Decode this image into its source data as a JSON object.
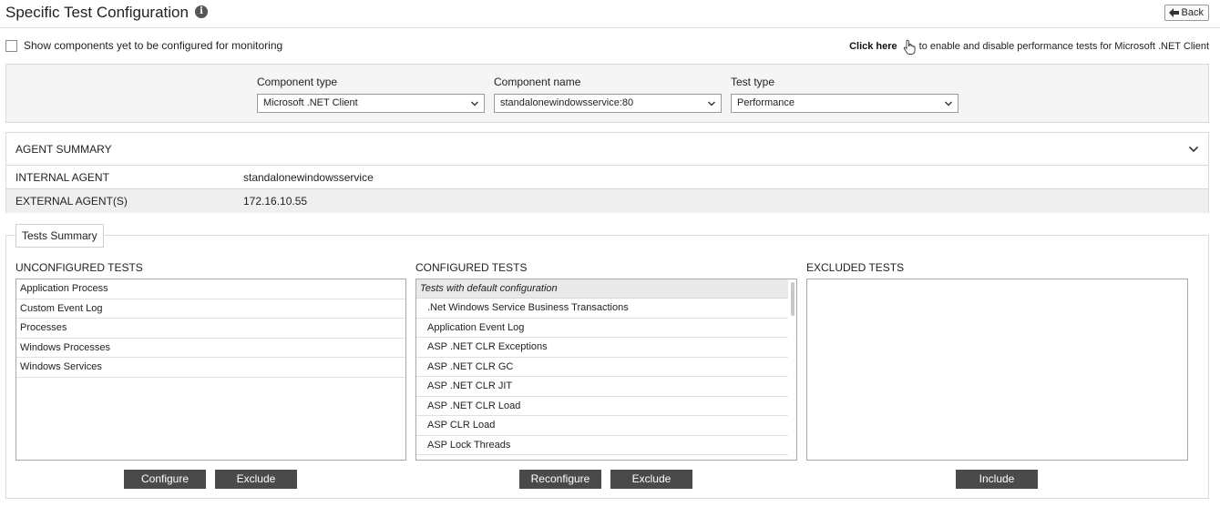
{
  "header": {
    "title": "Specific Test Configuration",
    "info_icon": "info-icon",
    "back_label": "Back",
    "back_icon": "back-arrow-icon"
  },
  "options": {
    "show_unconfigured_label": "Show components yet to be configured for monitoring",
    "show_unconfigured_checked": false,
    "click_here_label": "Click here",
    "click_here_suffix": "to enable and disable performance tests for Microsoft .NET Client"
  },
  "filters": {
    "component_type": {
      "label": "Component type",
      "value": "Microsoft .NET Client"
    },
    "component_name": {
      "label": "Component name",
      "value": "standalonewindowsservice:80"
    },
    "test_type": {
      "label": "Test type",
      "value": "Performance"
    }
  },
  "agent_summary": {
    "title": "AGENT SUMMARY",
    "rows": [
      {
        "key": "INTERNAL AGENT",
        "value": "standalonewindowsservice"
      },
      {
        "key": "EXTERNAL AGENT(S)",
        "value": "172.16.10.55"
      }
    ]
  },
  "tests_summary": {
    "tab_label": "Tests Summary",
    "unconfigured": {
      "label": "UNCONFIGURED TESTS",
      "items": [
        "Application Process",
        "Custom Event Log",
        "Processes",
        "Windows Processes",
        "Windows Services"
      ],
      "buttons": {
        "configure": "Configure",
        "exclude": "Exclude"
      }
    },
    "configured": {
      "label": "CONFIGURED TESTS",
      "group_header": "Tests with default configuration",
      "items": [
        ".Net Windows Service Business Transactions",
        "Application Event Log",
        "ASP .NET CLR Exceptions",
        "ASP .NET CLR GC",
        "ASP .NET CLR JIT",
        "ASP .NET CLR Load",
        "ASP CLR Load",
        "ASP Lock Threads"
      ],
      "buttons": {
        "reconfigure": "Reconfigure",
        "exclude": "Exclude"
      }
    },
    "excluded": {
      "label": "EXCLUDED TESTS",
      "items": [],
      "buttons": {
        "include": "Include"
      }
    }
  },
  "colors": {
    "button_bg": "#4a4a4a",
    "panel_bg": "#f5f5f5",
    "alt_row_bg": "#efefef",
    "group_header_bg": "#e9e9e9"
  }
}
